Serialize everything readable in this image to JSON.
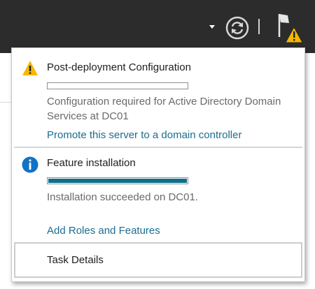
{
  "toolbar": {
    "dropdown_icon": "chevron-down-icon",
    "refresh_icon": "refresh-icon",
    "notifications_icon": "flag-warning-icon"
  },
  "notifications": [
    {
      "icon": "warning-icon",
      "title": "Post-deployment Configuration",
      "progress": 0,
      "message": "Configuration required for Active Directory Domain Services at DC01",
      "link": "Promote this server to a domain controller"
    },
    {
      "icon": "info-icon",
      "title": "Feature installation",
      "progress": 1.0,
      "message": "Installation succeeded on DC01.",
      "link": "Add Roles and Features"
    }
  ],
  "footer": {
    "task_details_label": "Task Details"
  },
  "colors": {
    "topbar": "#2c2c2c",
    "link": "#1a6e91",
    "progress_fill": "#0e6f8a",
    "warning": "#f5b800",
    "info": "#1273c4"
  }
}
